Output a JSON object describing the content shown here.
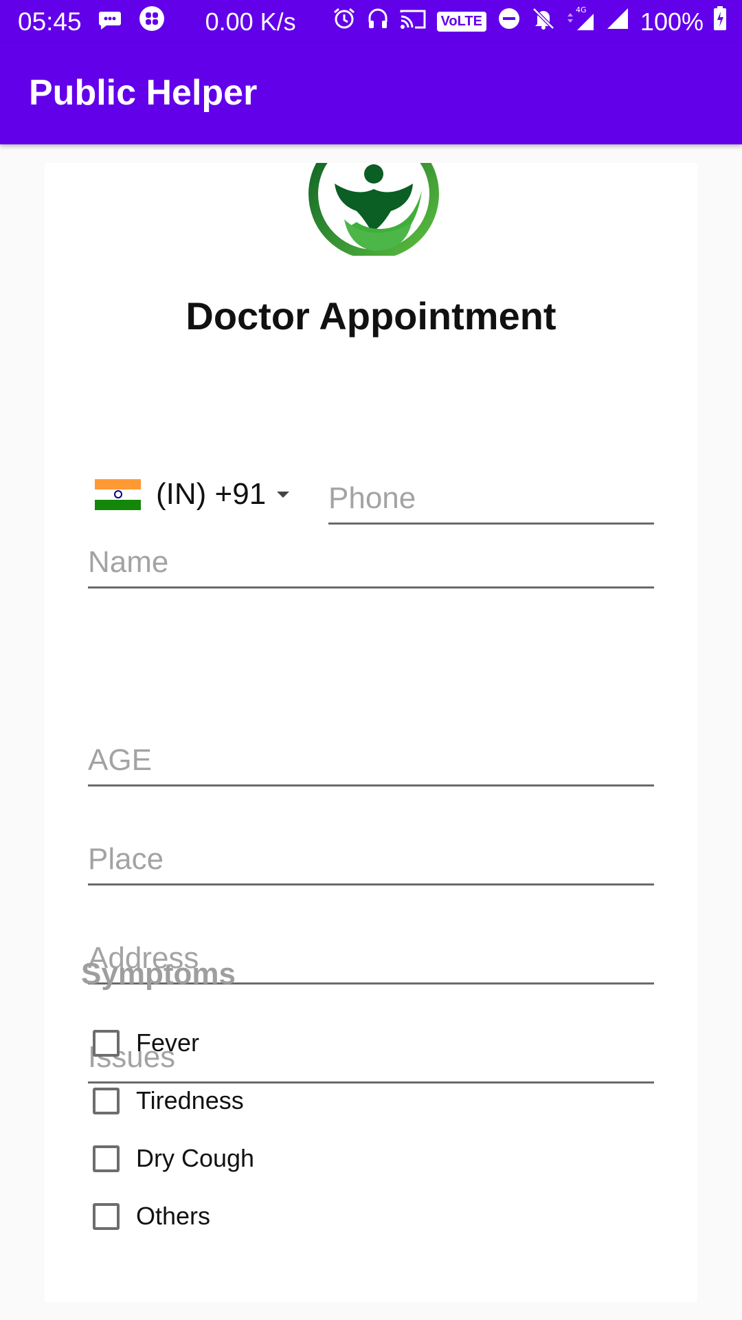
{
  "status_bar": {
    "time": "05:45",
    "net_speed": "0.00 K/s",
    "volte": "VoLTE",
    "network": "4G",
    "battery": "100%",
    "icons": [
      "message-icon",
      "app-icon",
      "alarm-icon",
      "headphones-icon",
      "cast-icon",
      "volte-icon",
      "dnd-icon",
      "bell-off-icon",
      "signal-4g-icon",
      "signal-icon",
      "battery-icon"
    ]
  },
  "app_bar": {
    "title": "Public Helper"
  },
  "form": {
    "title": "Doctor Appointment",
    "name_placeholder": "Name",
    "country_code": "(IN)  +91",
    "phone_placeholder": "Phone",
    "age_placeholder": "AGE",
    "place_placeholder": "Place",
    "address_placeholder": "Address",
    "issues_placeholder": "Issues",
    "symptoms_label": "Symptoms",
    "symptoms": [
      {
        "label": "Fever",
        "checked": false
      },
      {
        "label": "Tiredness",
        "checked": false
      },
      {
        "label": "Dry Cough",
        "checked": false
      },
      {
        "label": "Others",
        "checked": false
      }
    ]
  },
  "colors": {
    "primary": "#6200ea",
    "logo_dark_green": "#0b5e24",
    "logo_light_green": "#3fae3a",
    "hint_gray": "#a3a3a3",
    "underline_gray": "#6a6a6a"
  }
}
